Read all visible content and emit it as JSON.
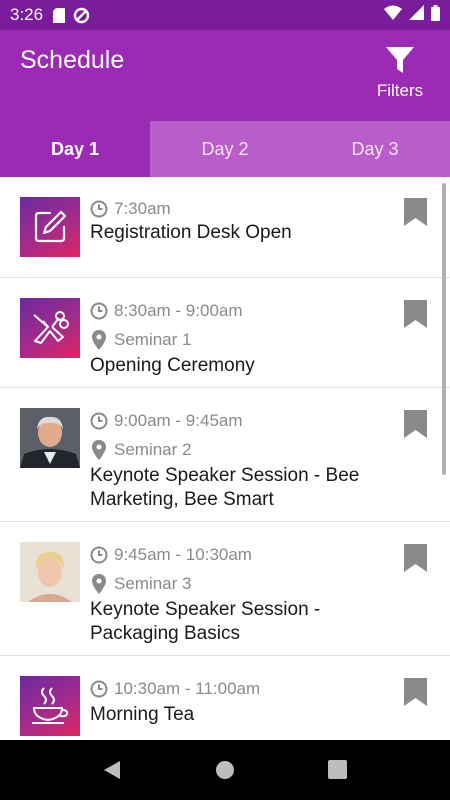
{
  "status": {
    "time": "3:26"
  },
  "header": {
    "title": "Schedule",
    "filters_label": "Filters"
  },
  "tabs": [
    {
      "label": "Day 1",
      "active": true
    },
    {
      "label": "Day 2",
      "active": false
    },
    {
      "label": "Day 3",
      "active": false
    }
  ],
  "events": [
    {
      "time": "7:30am",
      "location": "",
      "title": "Registration Desk Open",
      "icon": "edit-icon"
    },
    {
      "time": "8:30am - 9:00am",
      "location": "Seminar 1",
      "title": "Opening Ceremony",
      "icon": "ribbon-scissors-icon"
    },
    {
      "time": "9:00am - 9:45am",
      "location": "Seminar 2",
      "title": "Keynote Speaker Session - Bee Marketing, Bee Smart",
      "icon": "speaker-photo-man"
    },
    {
      "time": "9:45am - 10:30am",
      "location": "Seminar 3",
      "title": "Keynote Speaker Session - Packaging Basics",
      "icon": "speaker-photo-woman"
    },
    {
      "time": "10:30am - 11:00am",
      "location": "",
      "title": "Morning Tea",
      "icon": "coffee-cup-icon"
    }
  ],
  "colors": {
    "statusbar": "#7a1d9c",
    "appbar": "#9b2ab4",
    "tab_inactive": "#b95dca",
    "bookmark": "#8a8a8a"
  }
}
